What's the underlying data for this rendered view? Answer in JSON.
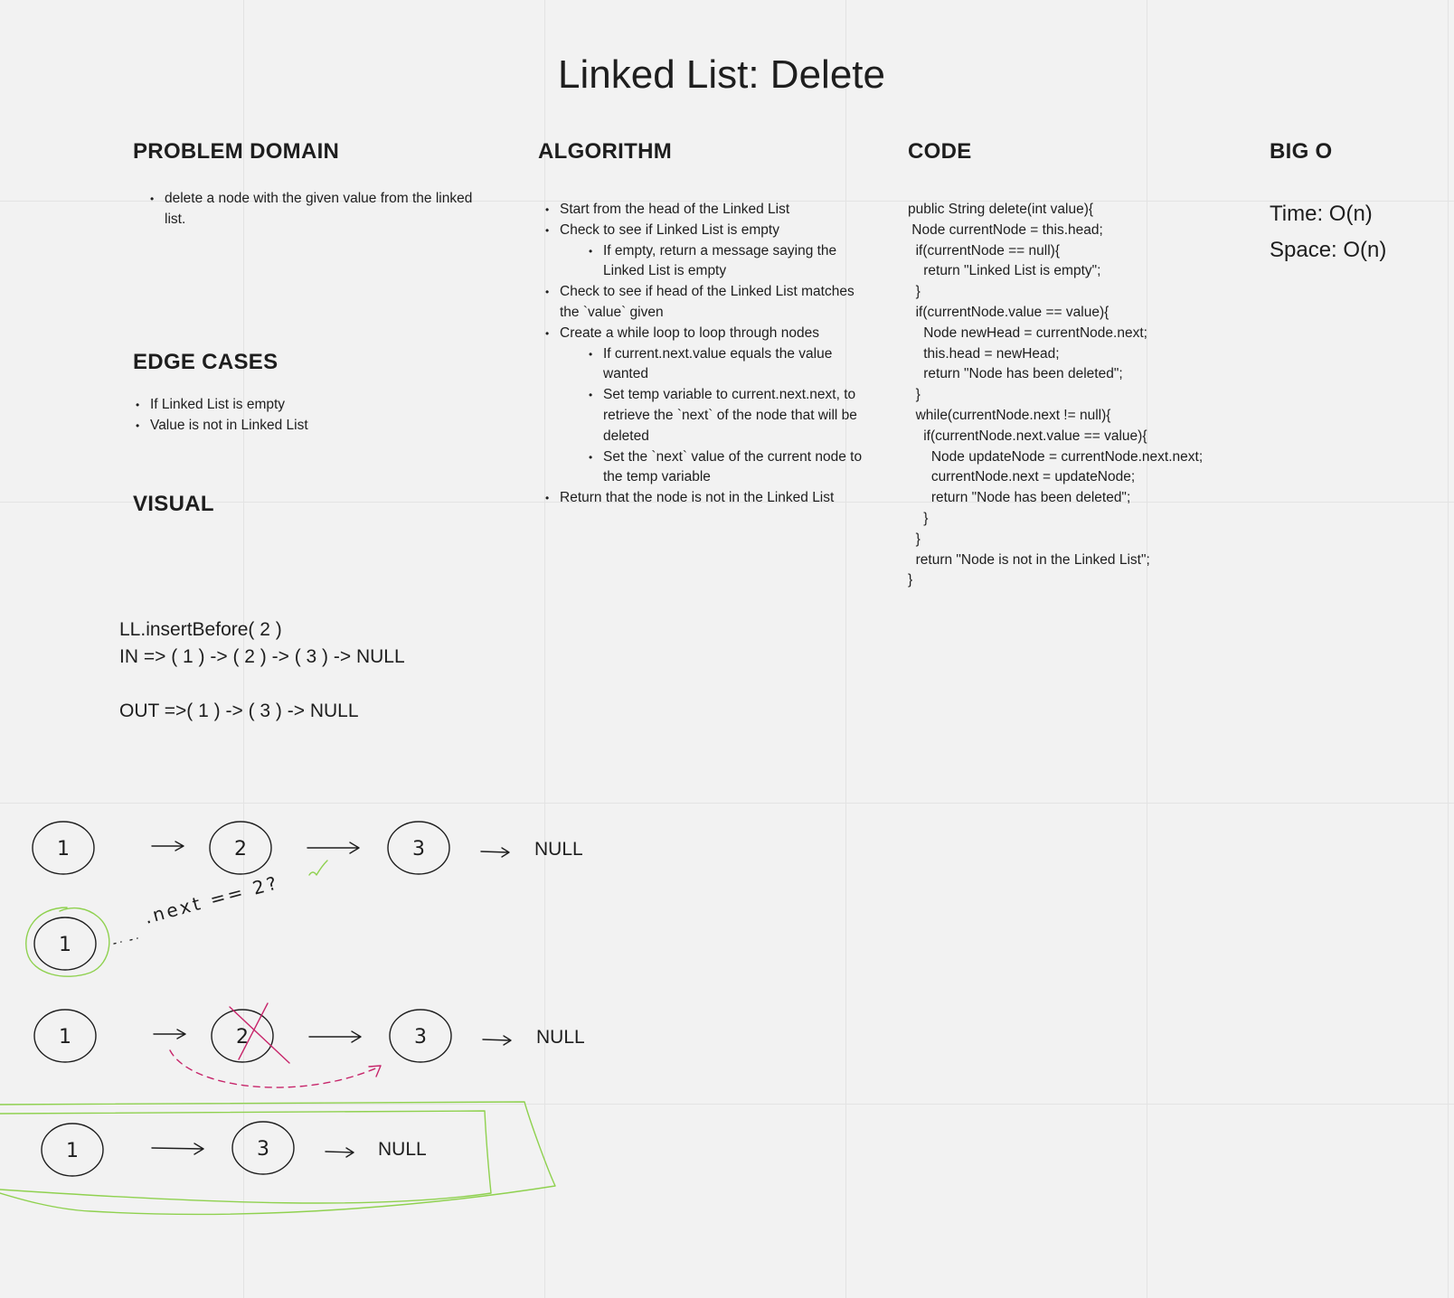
{
  "title": "Linked List: Delete",
  "problem_domain": {
    "heading": "PROBLEM DOMAIN",
    "items": [
      "delete a node with the given value from the linked list."
    ]
  },
  "edge_cases": {
    "heading": "EDGE CASES",
    "items": [
      "If Linked List is empty",
      "Value is not in Linked List"
    ]
  },
  "visual": {
    "heading": "VISUAL",
    "example": [
      "LL.insertBefore( 2 )",
      "IN => ( 1 ) -> ( 2 ) -> ( 3 ) -> NULL",
      "",
      "OUT =>( 1 ) -> ( 3 ) -> NULL"
    ]
  },
  "algorithm": {
    "heading": "ALGORITHM",
    "items": [
      {
        "text": "Start from the head of the Linked List",
        "level": 0
      },
      {
        "text": "Check to see if Linked List is empty",
        "level": 0
      },
      {
        "text": "If empty, return a message saying the Linked List is empty",
        "level": 1
      },
      {
        "text": "Check to see if head of the Linked List matches the `value` given",
        "level": 0
      },
      {
        "text": "Create a while loop to loop through nodes",
        "level": 0
      },
      {
        "text": "If current.next.value equals the value wanted",
        "level": 1
      },
      {
        "text": "Set temp variable to current.next.next, to retrieve the `next` of the node that will be deleted",
        "level": 1
      },
      {
        "text": "Set the `next` value of the current node to the temp variable",
        "level": 1
      },
      {
        "text": "Return that the node is not in the Linked List",
        "level": 0
      }
    ]
  },
  "code": {
    "heading": "CODE",
    "lines": [
      "public String delete(int value){",
      " Node currentNode = this.head;",
      "  if(currentNode == null){",
      "    return \"Linked List is empty\";",
      "  }",
      "  if(currentNode.value == value){",
      "    Node newHead = currentNode.next;",
      "    this.head = newHead;",
      "    return \"Node has been deleted\";",
      "  }",
      "  while(currentNode.next != null){",
      "    if(currentNode.next.value == value){",
      "      Node updateNode = currentNode.next.next;",
      "      currentNode.next = updateNode;",
      "      return \"Node has been deleted\";",
      "    }",
      "  }",
      "  return \"Node is not in the Linked List\";",
      "}"
    ]
  },
  "big_o": {
    "heading": "BIG O",
    "time": "Time: O(n)",
    "space": "Space: O(n)"
  },
  "sketch": {
    "null_label": "NULL",
    "row1_nodes": [
      "1",
      "2",
      "3"
    ],
    "traversal_node": "1",
    "annotation": ".next == 2?",
    "row2_nodes": [
      "1",
      "2",
      "3"
    ],
    "result_nodes": [
      "1",
      "3"
    ],
    "colors": {
      "ink": "#1e1e1e",
      "highlight": "#8fd14f",
      "strike": "#c7256a"
    }
  }
}
